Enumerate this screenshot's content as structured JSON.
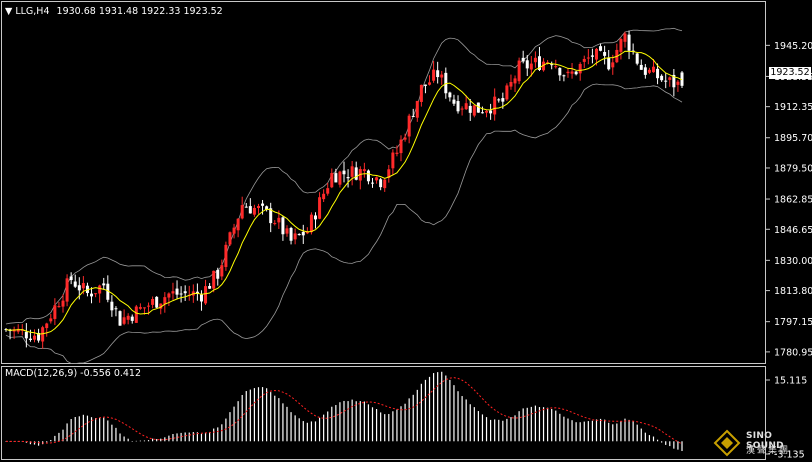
{
  "header": {
    "marker": "▼",
    "symbol": "LLG,H4",
    "ohlc": "1930.68 1931.48 1922.33 1923.52"
  },
  "current_price_label": "1923.52",
  "macd_header": "MACD(12,26,9) -0.556 0.412",
  "watermark": {
    "line1": "SINO SOUND",
    "line2": "漢聲集團"
  },
  "colors": {
    "background": "#000000",
    "bull_candle": "#ff2a2a",
    "bear_candle": "#ffffff",
    "moving_average": "#ffff00",
    "bollinger": "#9a9a9a",
    "macd_hist": "#ffffff",
    "macd_signal": "#ff2020"
  },
  "chart_data": [
    {
      "type": "candlestick",
      "title": "LLG,H4",
      "ylim": [
        1775,
        1962
      ],
      "y_ticks": [
        "1945.20",
        "1928.55",
        "1912.35",
        "1895.70",
        "1879.50",
        "1862.85",
        "1846.65",
        "1830.00",
        "1813.80",
        "1797.15",
        "1780.95"
      ],
      "last_close": 1923.52,
      "overlays": [
        "bollinger_bands",
        "moving_average"
      ],
      "grid": false
    },
    {
      "type": "bar",
      "title": "MACD(12,26,9)",
      "values_label": "-0.556 0.412",
      "ylim": [
        -3.135,
        15.115
      ],
      "y_ticks": [
        "15.115",
        "-3.135"
      ],
      "series": [
        {
          "name": "MACD",
          "kind": "histogram"
        },
        {
          "name": "Signal",
          "kind": "dotted_line"
        }
      ]
    }
  ]
}
